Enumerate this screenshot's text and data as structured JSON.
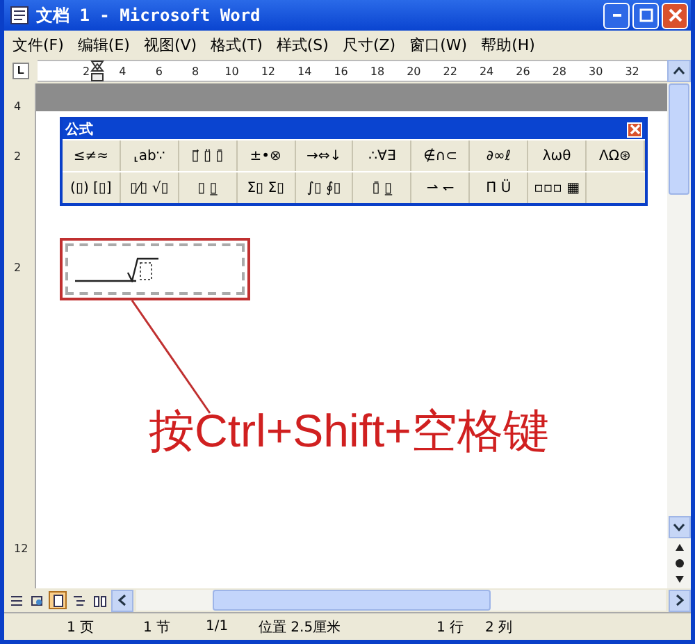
{
  "window": {
    "title": "文档 1 - Microsoft Word"
  },
  "menu": [
    "文件(F)",
    "编辑(E)",
    "视图(V)",
    "格式(T)",
    "样式(S)",
    "尺寸(Z)",
    "窗口(W)",
    "帮助(H)"
  ],
  "ruler": {
    "tab_selector": "L",
    "numbers": [
      "2",
      "4",
      "6",
      "8",
      "10",
      "12",
      "14",
      "16",
      "18",
      "20",
      "22",
      "24",
      "26",
      "28",
      "30",
      "32"
    ]
  },
  "vertical_ruler": [
    "4",
    "2",
    "2",
    "12"
  ],
  "equation_toolbar": {
    "title": "公式",
    "rows": [
      [
        "≤≠≈",
        "⸤ab∵",
        "▯⃗ ▯̈ ▯̄",
        "±•⊗",
        "→⇔↓",
        "∴∀∃",
        "∉∩⊂",
        "∂∞ℓ",
        "λωθ",
        "ΛΩ⊛"
      ],
      [
        "(▯) [▯]",
        "▯⁄▯ √▯",
        "▯ ▯̲",
        "Σ▯ Σ▯",
        "∫▯ ∮▯",
        "▯̄ ▯̲",
        "⇀ ↽",
        "Π̇ Ü",
        "▫▫▫ ▦"
      ]
    ]
  },
  "annotation": "按Ctrl+Shift+空格键",
  "view_buttons": [
    {
      "kind": "normal",
      "selected": false
    },
    {
      "kind": "web",
      "selected": false
    },
    {
      "kind": "page",
      "selected": true
    },
    {
      "kind": "outline",
      "selected": false
    },
    {
      "kind": "reading",
      "selected": false
    }
  ],
  "status_bar": [
    "1 页",
    "1 节",
    "1/1",
    "位置 2.5厘米",
    "1 行",
    "2 列"
  ]
}
